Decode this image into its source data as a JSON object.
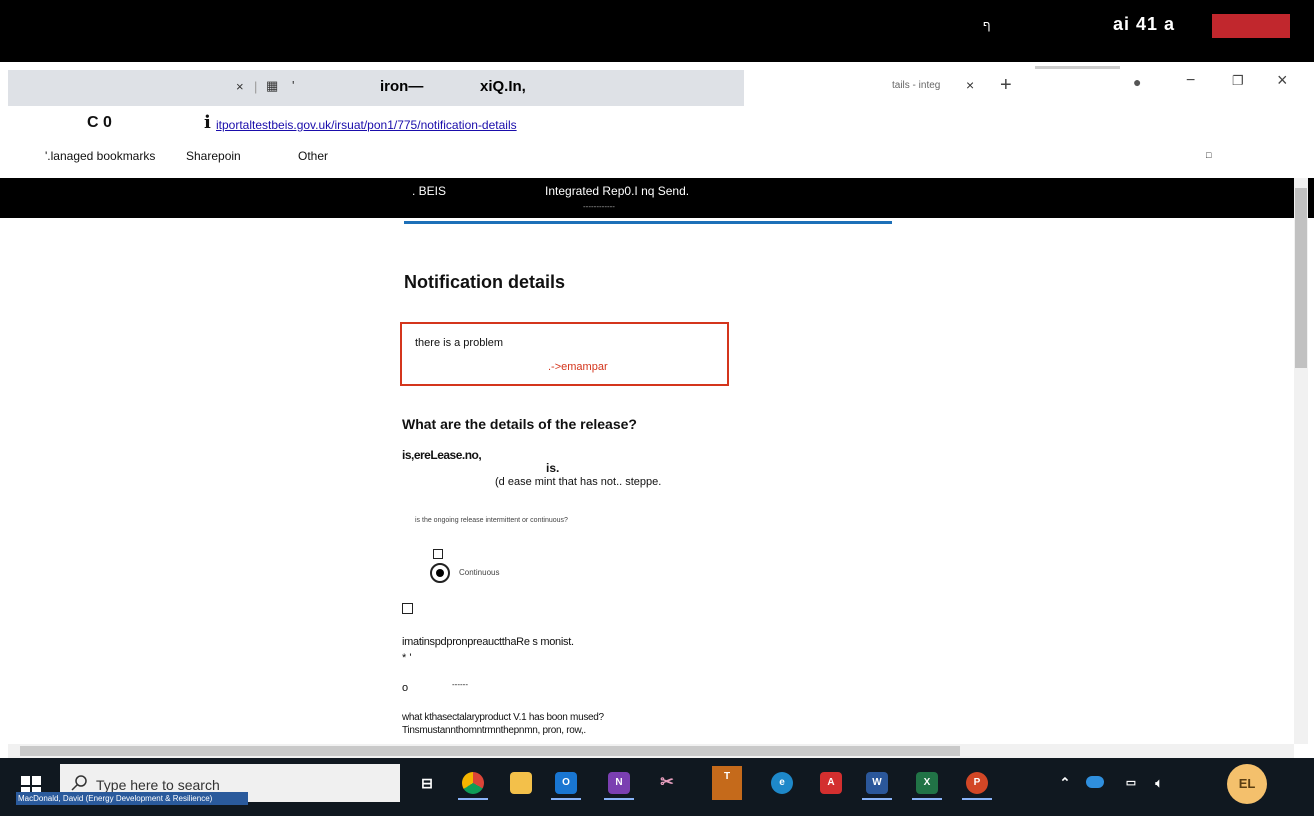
{
  "topbar": {
    "glyph": "ף",
    "caption": "ai 41 a"
  },
  "tabs": {
    "close1": "×",
    "sep": "|",
    "icon1": "▦",
    "tick": "'",
    "bold1": "iron—",
    "bold2": "xiQ.In,",
    "active_tab": "tails - integ",
    "close_active": "×",
    "new_tab": "+"
  },
  "window": {
    "profile_icon": "●",
    "minimize": "−",
    "restore": "❐",
    "close": "×"
  },
  "address": {
    "nav": "C 0",
    "info": "i",
    "url": "itportaltestbeis.gov.uk/irsuat/pon1/775/notification-details"
  },
  "bookmarks": {
    "managed": "'.lanaged bookmarks",
    "sharepoint": "Sharepoin",
    "other": "Other",
    "reading_list": "□"
  },
  "site_header": {
    "brand": ". BEIS",
    "service": "Integrated Rep0.I nq Send.",
    "dashes": "------------"
  },
  "main": {
    "title": "Notification details",
    "error_heading": "there is a problem",
    "error_link": ".->emampar",
    "question1": "What are the details of the release?",
    "answer1": "is,ereLease.no,",
    "answer1b": "is.",
    "hint1": "(d ease mint that has not.. steppe.",
    "question2": "is the ongoing release intermittent or continuous?",
    "radio_label": "Continuous",
    "para1": "imatinspdpronpreauctthaRe  s monist.",
    "star": "*     '",
    "o_line": "o",
    "o_dash": "------",
    "para2": "what kthasectalaryproduct V.1 has boon mused?",
    "para3": "Tinsmustannthomntrmnthepnmn, pron, row,."
  },
  "taskbar": {
    "search_placeholder": "Type here to search",
    "tooltip": "MacDonald, David (Energy Development & Resilience)",
    "avatar": "EL",
    "apps": [
      "task-view",
      "chrome",
      "file-explorer",
      "outlook",
      "onenote",
      "snipping",
      "teams",
      "edge",
      "acrobat",
      "word",
      "excel",
      "powerpoint"
    ]
  }
}
